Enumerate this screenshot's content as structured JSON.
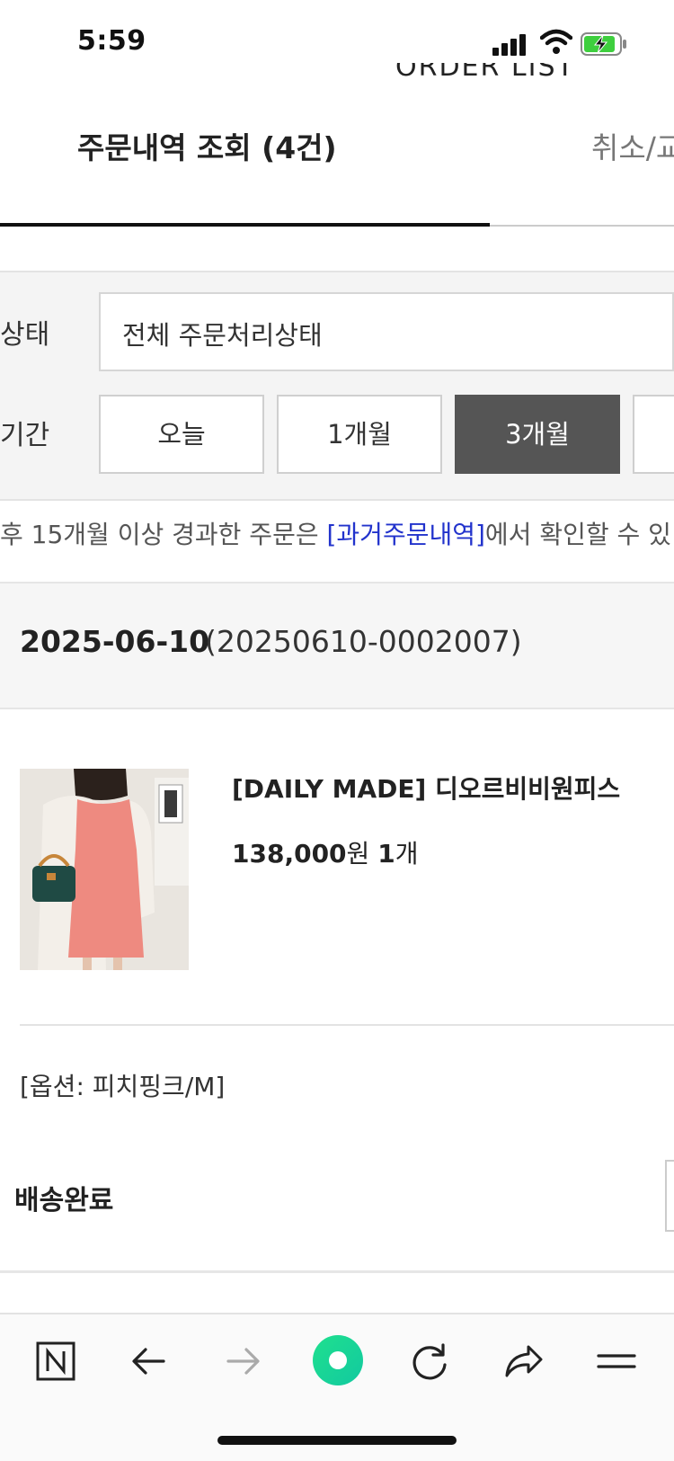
{
  "status_bar": {
    "time": "5:59"
  },
  "page": {
    "cut_title": "ORDER LIST"
  },
  "tabs": [
    {
      "label": "주문내역 조회 (4건)",
      "active": true
    },
    {
      "label": "취소/교",
      "active": false
    }
  ],
  "filter": {
    "status_label": "상태",
    "status_value": "전체 주문처리상태",
    "period_label": "기간",
    "periods": [
      {
        "label": "오늘",
        "active": false
      },
      {
        "label": "1개월",
        "active": false
      },
      {
        "label": "3개월",
        "active": true
      }
    ]
  },
  "notice": {
    "prefix": "후 15개월 이상 경과한 주문은 ",
    "link": "[과거주문내역]",
    "suffix": "에서 확인할 수 있"
  },
  "order": {
    "date": "2025-06-10",
    "number": "(20250610-0002007)",
    "product_name": "[DAILY MADE] 디오르비비원피스",
    "price": "138,000",
    "price_unit": "원",
    "quantity": "1",
    "quantity_unit": "개",
    "option": "[옵션: 피치핑크/M]",
    "status": "배송완료"
  },
  "colors": {
    "accent_link": "#2233cc",
    "active_period_bg": "#555555",
    "nav_center": "#19d37a"
  }
}
